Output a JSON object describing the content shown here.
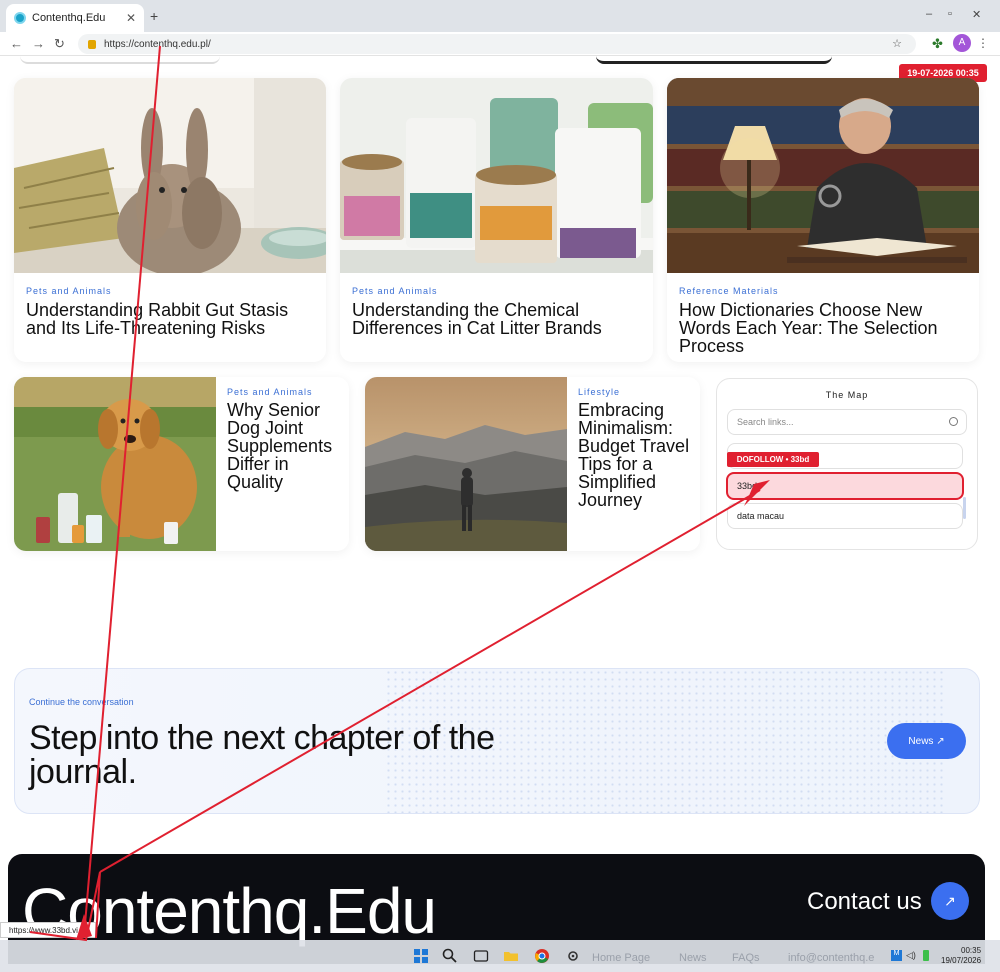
{
  "browser": {
    "tab_title": "Contenthq.Edu",
    "new_tab": "+",
    "url": "https://contenthq.edu.pl/",
    "profile_initial": "A",
    "window_controls": [
      "–",
      "▫",
      "✕"
    ]
  },
  "page": {
    "date_badge": "19-07-2026 00:35",
    "top_cards": [
      {
        "category": "Pets and Animals",
        "title": "Understanding Rabbit Gut Stasis and Its Life-Threatening Risks"
      },
      {
        "category": "Pets and Animals",
        "title": "Understanding the Chemical Differences in Cat Litter Brands"
      },
      {
        "category": "Reference Materials",
        "title": "How Dictionaries Choose New Words Each Year: The Selection Process"
      }
    ],
    "side_cards": [
      {
        "category": "Pets and Animals",
        "title": "Why Senior Dog Joint Supplements Differ in Quality"
      },
      {
        "category": "Lifestyle",
        "title": "Embracing Minimalism: Budget Travel Tips for a Simplified Journey"
      }
    ],
    "map": {
      "title": "The Map",
      "search_placeholder": "Search links...",
      "links": [
        "",
        "33bd",
        "data macau"
      ],
      "dofollow_badge": "DOFOLLOW • 33bd"
    },
    "cta": {
      "kicker": "Continue the conversation",
      "headline": "Step into the next chapter of the journal.",
      "button": "News ↗"
    },
    "footer": {
      "brand": "Contenthq.Edu",
      "contact": "Contact us",
      "contact_icon": "↗"
    },
    "status_url": "https://www.33bd.vi"
  },
  "taskbar": {
    "nav_links": [
      "Home Page",
      "News",
      "FAQs",
      "info@contenthq.e"
    ],
    "time": "00:35",
    "date": "19/07/2026"
  },
  "colors": {
    "accent_blue": "#3b6ff0",
    "badge_red": "#e02030",
    "footer_bg": "#0c0d12"
  }
}
